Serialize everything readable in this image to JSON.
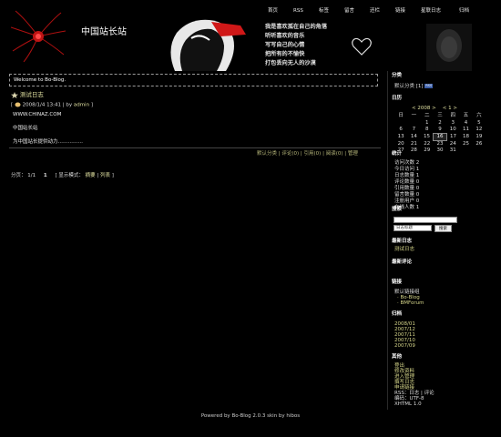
{
  "header": {
    "site_title": "中国站长站",
    "nav": [
      "首页",
      "RSS",
      "标签",
      "留言",
      "还栏",
      "链接",
      "星联日志",
      "归档"
    ],
    "poem": [
      "我是喜欢孤在自己的角落",
      "听听喜欢的音乐",
      "写写自己的心情",
      "把所有的不愉快",
      "打包丢向无人的沙漠"
    ]
  },
  "welcome": "Welcome to Bo-Blog.",
  "post": {
    "title": "测试日志",
    "date": "2008/1/4 13:41",
    "by_label": "by",
    "author": "admin",
    "lines": [
      "WWW.CHINAZ.COM",
      "中国站长站",
      "为中国站长提供动力……………"
    ],
    "actions": [
      "默认分类",
      "评论(0)",
      "引用(0)",
      "阅读(0)",
      "管理"
    ]
  },
  "pager": {
    "label": "分页：",
    "pages": "1/1",
    "current": "1",
    "mode_label": "显示模式：",
    "modes": [
      "摘要",
      "列表"
    ]
  },
  "sidebar": {
    "category_title": "分类",
    "category_item": "默认分类",
    "category_count": "[1]",
    "rss_badge": "RSS",
    "calendar_title": "日历",
    "calendar_year": "2008",
    "calendar_month": "1",
    "weekdays": [
      "日",
      "一",
      "二",
      "三",
      "四",
      "五",
      "六"
    ],
    "weeks": [
      [
        "",
        "",
        "1",
        "2",
        "3",
        "4",
        "5"
      ],
      [
        "6",
        "7",
        "8",
        "9",
        "10",
        "11",
        "12"
      ],
      [
        "13",
        "14",
        "15",
        "16",
        "17",
        "18",
        "19"
      ],
      [
        "20",
        "21",
        "22",
        "23",
        "24",
        "25",
        "26"
      ],
      [
        "27",
        "28",
        "29",
        "30",
        "31",
        "",
        ""
      ]
    ],
    "today": "16",
    "stats_title": "统计",
    "stats": [
      "访问次数 2",
      "今日访问 1",
      "日志数量 1",
      "评论数量 0",
      "引用数量 0",
      "留言数量 0",
      "注册用户 0",
      "在线人数 1"
    ],
    "search_title": "搜索",
    "search_select": "日志标题",
    "search_button": "搜索",
    "recent_title": "最新日志",
    "recent_item": "测试日志",
    "comments_title": "最新评论",
    "links_title": "链接",
    "links_group": "默认链接组",
    "links": [
      "· Bo-Blog",
      "· BMForum"
    ],
    "archive_title": "归档",
    "archives": [
      "2008/01",
      "2007/12",
      "2007/11",
      "2007/10",
      "2007/09"
    ],
    "other_title": "其他",
    "other": [
      "登出",
      "修改资料",
      "进入管理",
      "撰写日志",
      "申请链接",
      "RSS：日志 | 评论",
      "编码：UTF-8",
      "XHTML 1.0"
    ]
  },
  "footer": "Powered by Bo-Blog 2.0.3   skin by hibos"
}
